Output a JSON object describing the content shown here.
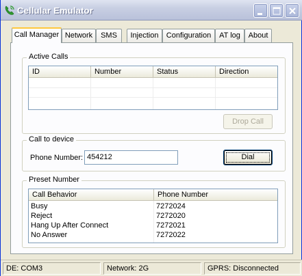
{
  "window": {
    "title": "Cellular Emulator"
  },
  "tabs": [
    {
      "label": "Call Manager",
      "active": true
    },
    {
      "label": "Network",
      "active": false
    },
    {
      "label": "SMS",
      "active": false
    },
    {
      "label": "Injection",
      "active": false
    },
    {
      "label": "Configuration",
      "active": false
    },
    {
      "label": "AT log",
      "active": false
    },
    {
      "label": "About",
      "active": false
    }
  ],
  "active_calls": {
    "title": "Active Calls",
    "columns": [
      "ID",
      "Number",
      "Status",
      "Direction"
    ],
    "rows": [],
    "drop_call_label": "Drop Call"
  },
  "call_to_device": {
    "title": "Call to device",
    "phone_label": "Phone Number:",
    "phone_value": "454212",
    "dial_label": "Dial"
  },
  "preset_number": {
    "title": "Preset Number",
    "columns": [
      "Call Behavior",
      "Phone Number"
    ],
    "rows": [
      {
        "behavior": "Busy",
        "number": "7272024"
      },
      {
        "behavior": "Reject",
        "number": "7272020"
      },
      {
        "behavior": "Hang Up After Connect",
        "number": "7272021"
      },
      {
        "behavior": "No Answer",
        "number": "7272022"
      }
    ]
  },
  "status_bar": {
    "de": "DE: COM3",
    "network": "Network: 2G",
    "gprs": "GPRS: Disconnected"
  },
  "colors": {
    "title_text": "#ffffff",
    "tab_highlight": "#ffc83c",
    "list_border": "#7f9db9"
  }
}
